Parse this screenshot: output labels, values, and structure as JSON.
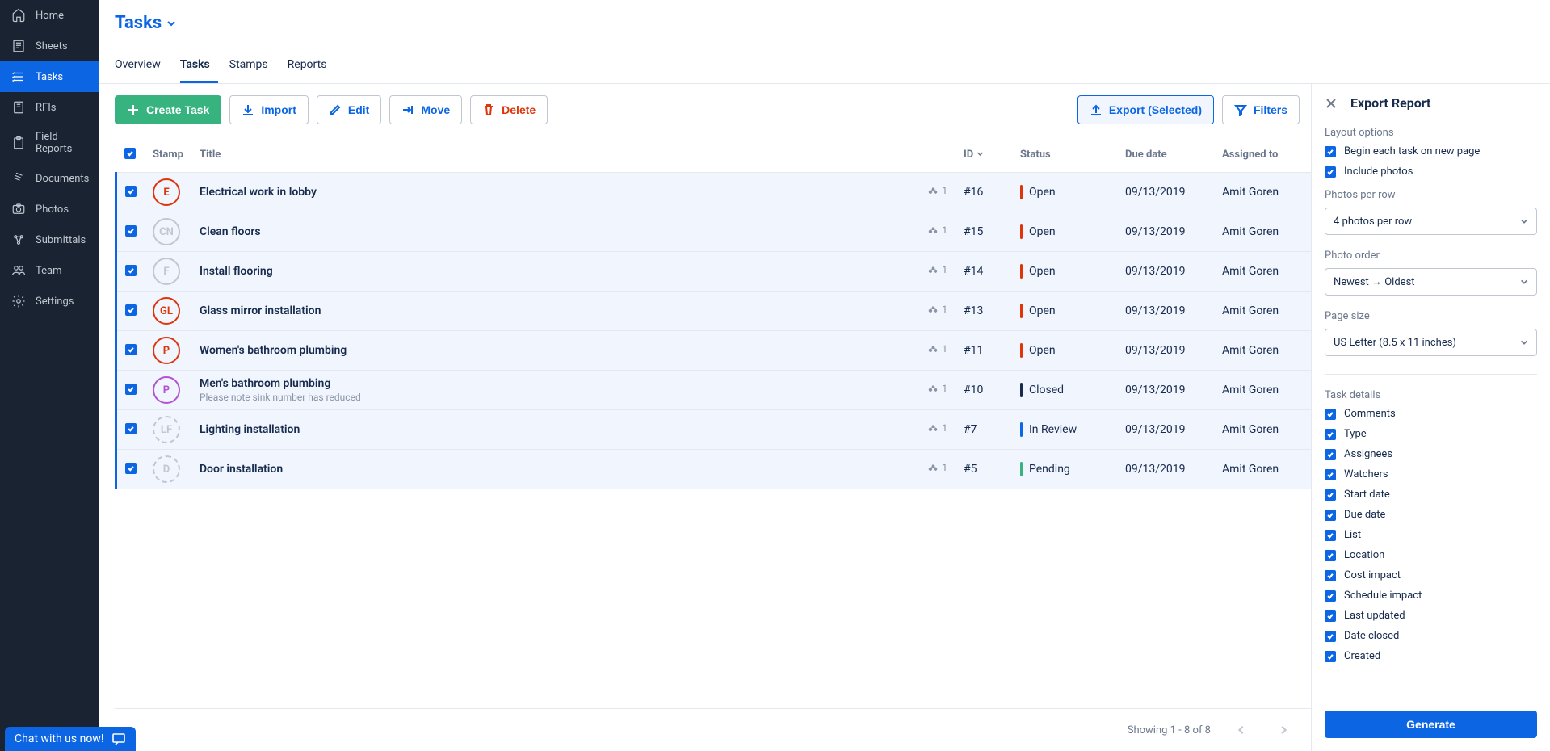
{
  "sidebar": {
    "items": [
      {
        "label": "Home",
        "icon": "home-icon",
        "active": false
      },
      {
        "label": "Sheets",
        "icon": "sheets-icon",
        "active": false
      },
      {
        "label": "Tasks",
        "icon": "tasks-icon",
        "active": true
      },
      {
        "label": "RFIs",
        "icon": "rfis-icon",
        "active": false
      },
      {
        "label": "Field Reports",
        "icon": "reports-icon",
        "active": false
      },
      {
        "label": "Documents",
        "icon": "documents-icon",
        "active": false
      },
      {
        "label": "Photos",
        "icon": "photos-icon",
        "active": false
      },
      {
        "label": "Submittals",
        "icon": "submittals-icon",
        "active": false
      },
      {
        "label": "Team",
        "icon": "team-icon",
        "active": false
      },
      {
        "label": "Settings",
        "icon": "settings-icon",
        "active": false
      }
    ]
  },
  "header": {
    "title": "Tasks"
  },
  "tabs": [
    {
      "label": "Overview",
      "active": false
    },
    {
      "label": "Tasks",
      "active": true
    },
    {
      "label": "Stamps",
      "active": false
    },
    {
      "label": "Reports",
      "active": false
    }
  ],
  "toolbar": {
    "create_label": "Create Task",
    "import_label": "Import",
    "edit_label": "Edit",
    "move_label": "Move",
    "delete_label": "Delete",
    "export_label": "Export (Selected)",
    "filters_label": "Filters"
  },
  "columns": {
    "stamp": "Stamp",
    "title": "Title",
    "id": "ID",
    "status": "Status",
    "due": "Due date",
    "assigned": "Assigned to"
  },
  "status_colors": {
    "Open": "#de350b",
    "Closed": "#172b4d",
    "In Review": "#0c66e4",
    "Pending": "#36b37e"
  },
  "tasks": [
    {
      "stamp": "E",
      "stamp_color": "#de350b",
      "stamp_dashed": false,
      "title": "Electrical work in lobby",
      "subtitle": "",
      "watchers": "1",
      "id": "#16",
      "status": "Open",
      "due": "09/13/2019",
      "assigned": "Amit Goren"
    },
    {
      "stamp": "CN",
      "stamp_color": "#c1c7d0",
      "stamp_dashed": false,
      "title": "Clean floors",
      "subtitle": "",
      "watchers": "1",
      "id": "#15",
      "status": "Open",
      "due": "09/13/2019",
      "assigned": "Amit Goren"
    },
    {
      "stamp": "F",
      "stamp_color": "#c1c7d0",
      "stamp_dashed": false,
      "title": "Install flooring",
      "subtitle": "",
      "watchers": "1",
      "id": "#14",
      "status": "Open",
      "due": "09/13/2019",
      "assigned": "Amit Goren"
    },
    {
      "stamp": "GL",
      "stamp_color": "#de350b",
      "stamp_dashed": false,
      "title": "Glass mirror installation",
      "subtitle": "",
      "watchers": "1",
      "id": "#13",
      "status": "Open",
      "due": "09/13/2019",
      "assigned": "Amit Goren"
    },
    {
      "stamp": "P",
      "stamp_color": "#de350b",
      "stamp_dashed": false,
      "title": "Women's bathroom plumbing",
      "subtitle": "",
      "watchers": "1",
      "id": "#11",
      "status": "Open",
      "due": "09/13/2019",
      "assigned": "Amit Goren"
    },
    {
      "stamp": "P",
      "stamp_color": "#b153d3",
      "stamp_dashed": false,
      "title": "Men's bathroom plumbing",
      "subtitle": "Please note sink number has reduced",
      "watchers": "1",
      "id": "#10",
      "status": "Closed",
      "due": "09/13/2019",
      "assigned": "Amit Goren"
    },
    {
      "stamp": "LF",
      "stamp_color": "#c1c7d0",
      "stamp_dashed": true,
      "title": "Lighting installation",
      "subtitle": "",
      "watchers": "1",
      "id": "#7",
      "status": "In Review",
      "due": "09/13/2019",
      "assigned": "Amit Goren"
    },
    {
      "stamp": "D",
      "stamp_color": "#c1c7d0",
      "stamp_dashed": true,
      "title": "Door installation",
      "subtitle": "",
      "watchers": "1",
      "id": "#5",
      "status": "Pending",
      "due": "09/13/2019",
      "assigned": "Amit Goren"
    }
  ],
  "footer": {
    "showing": "Showing 1 - 8 of 8"
  },
  "export": {
    "title": "Export Report",
    "layout_label": "Layout options",
    "begin_new_page_label": "Begin each task on new page",
    "include_photos_label": "Include photos",
    "photos_per_row_label": "Photos per row",
    "photos_per_row_value": "4 photos per row",
    "photo_order_label": "Photo order",
    "photo_order_value": "Newest → Oldest",
    "page_size_label": "Page size",
    "page_size_value": "US Letter (8.5 x 11 inches)",
    "task_details_label": "Task details",
    "details": [
      "Comments",
      "Type",
      "Assignees",
      "Watchers",
      "Start date",
      "Due date",
      "List",
      "Location",
      "Cost impact",
      "Schedule impact",
      "Last updated",
      "Date closed",
      "Created"
    ],
    "generate_label": "Generate"
  },
  "chat": {
    "label": "Chat with us now!"
  }
}
